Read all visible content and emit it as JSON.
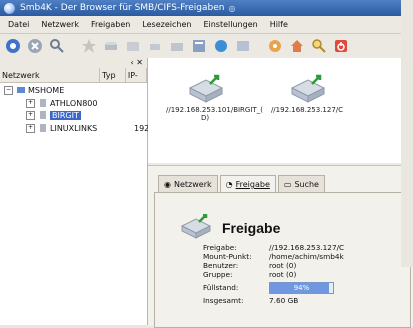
{
  "window": {
    "title": "Smb4K - Der Browser für SMB/CIFS-Freigaben"
  },
  "menu": [
    "Datei",
    "Netzwerk",
    "Freigaben",
    "Lesezeichen",
    "Einstellungen",
    "Hilfe"
  ],
  "tree": {
    "headers": [
      "Netzwerk",
      "Typ",
      "IP-"
    ],
    "items": [
      {
        "label": "MSHOME",
        "level": 0,
        "expander": "-"
      },
      {
        "label": "ATHLON800",
        "level": 1,
        "expander": "+"
      },
      {
        "label": "BIRGIT",
        "level": 1,
        "expander": "+",
        "selected": true
      },
      {
        "label": "LINUXLINKS",
        "level": 1,
        "expander": "+",
        "ip": "192"
      }
    ]
  },
  "shares": [
    {
      "label": "//192.168.253.101/BIRGIT_(",
      "sublabel": "D)"
    },
    {
      "label": "//192.168.253.127/C",
      "sublabel": ""
    }
  ],
  "tabs": [
    "Netzwerk",
    "Freigabe",
    "Suche"
  ],
  "details": {
    "title": "Freigabe",
    "props": [
      {
        "k": "Freigabe:",
        "v": "//192.168.253.127/C"
      },
      {
        "k": "Mount-Punkt:",
        "v": "/home/achim/smb4k"
      },
      {
        "k": "Benutzer:",
        "v": "root (0)"
      },
      {
        "k": "Gruppe:",
        "v": "root (0)"
      }
    ],
    "fuell_label": "Füllstand:",
    "fuell_value": "94%",
    "fuell_fraction": 0.94,
    "insgesamt_label": "Insgesamt:",
    "insgesamt_value": "7.60 GB"
  },
  "colors": {
    "accent": "#3c67c8"
  }
}
